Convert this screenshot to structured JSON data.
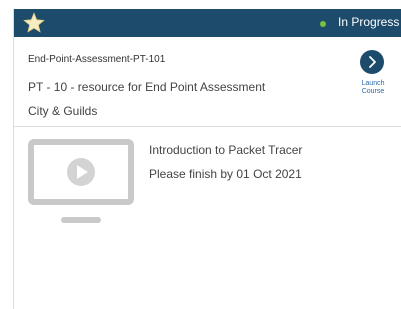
{
  "header": {
    "status": "In Progress",
    "status_color": "#7ac143",
    "background_color": "#1c4b6b",
    "favorite_icon": "star-icon"
  },
  "course": {
    "code": "End-Point-Assessment-PT-101",
    "title": "PT - 10 - resource for End Point Assessment",
    "provider": "City & Guilds",
    "launch_label": "Launch Course",
    "launch_icon": "chevron-right-icon"
  },
  "resource": {
    "icon": "video-monitor-icon",
    "name": "Introduction to Packet Tracer",
    "due": "Please finish by 01 Oct 2021"
  }
}
